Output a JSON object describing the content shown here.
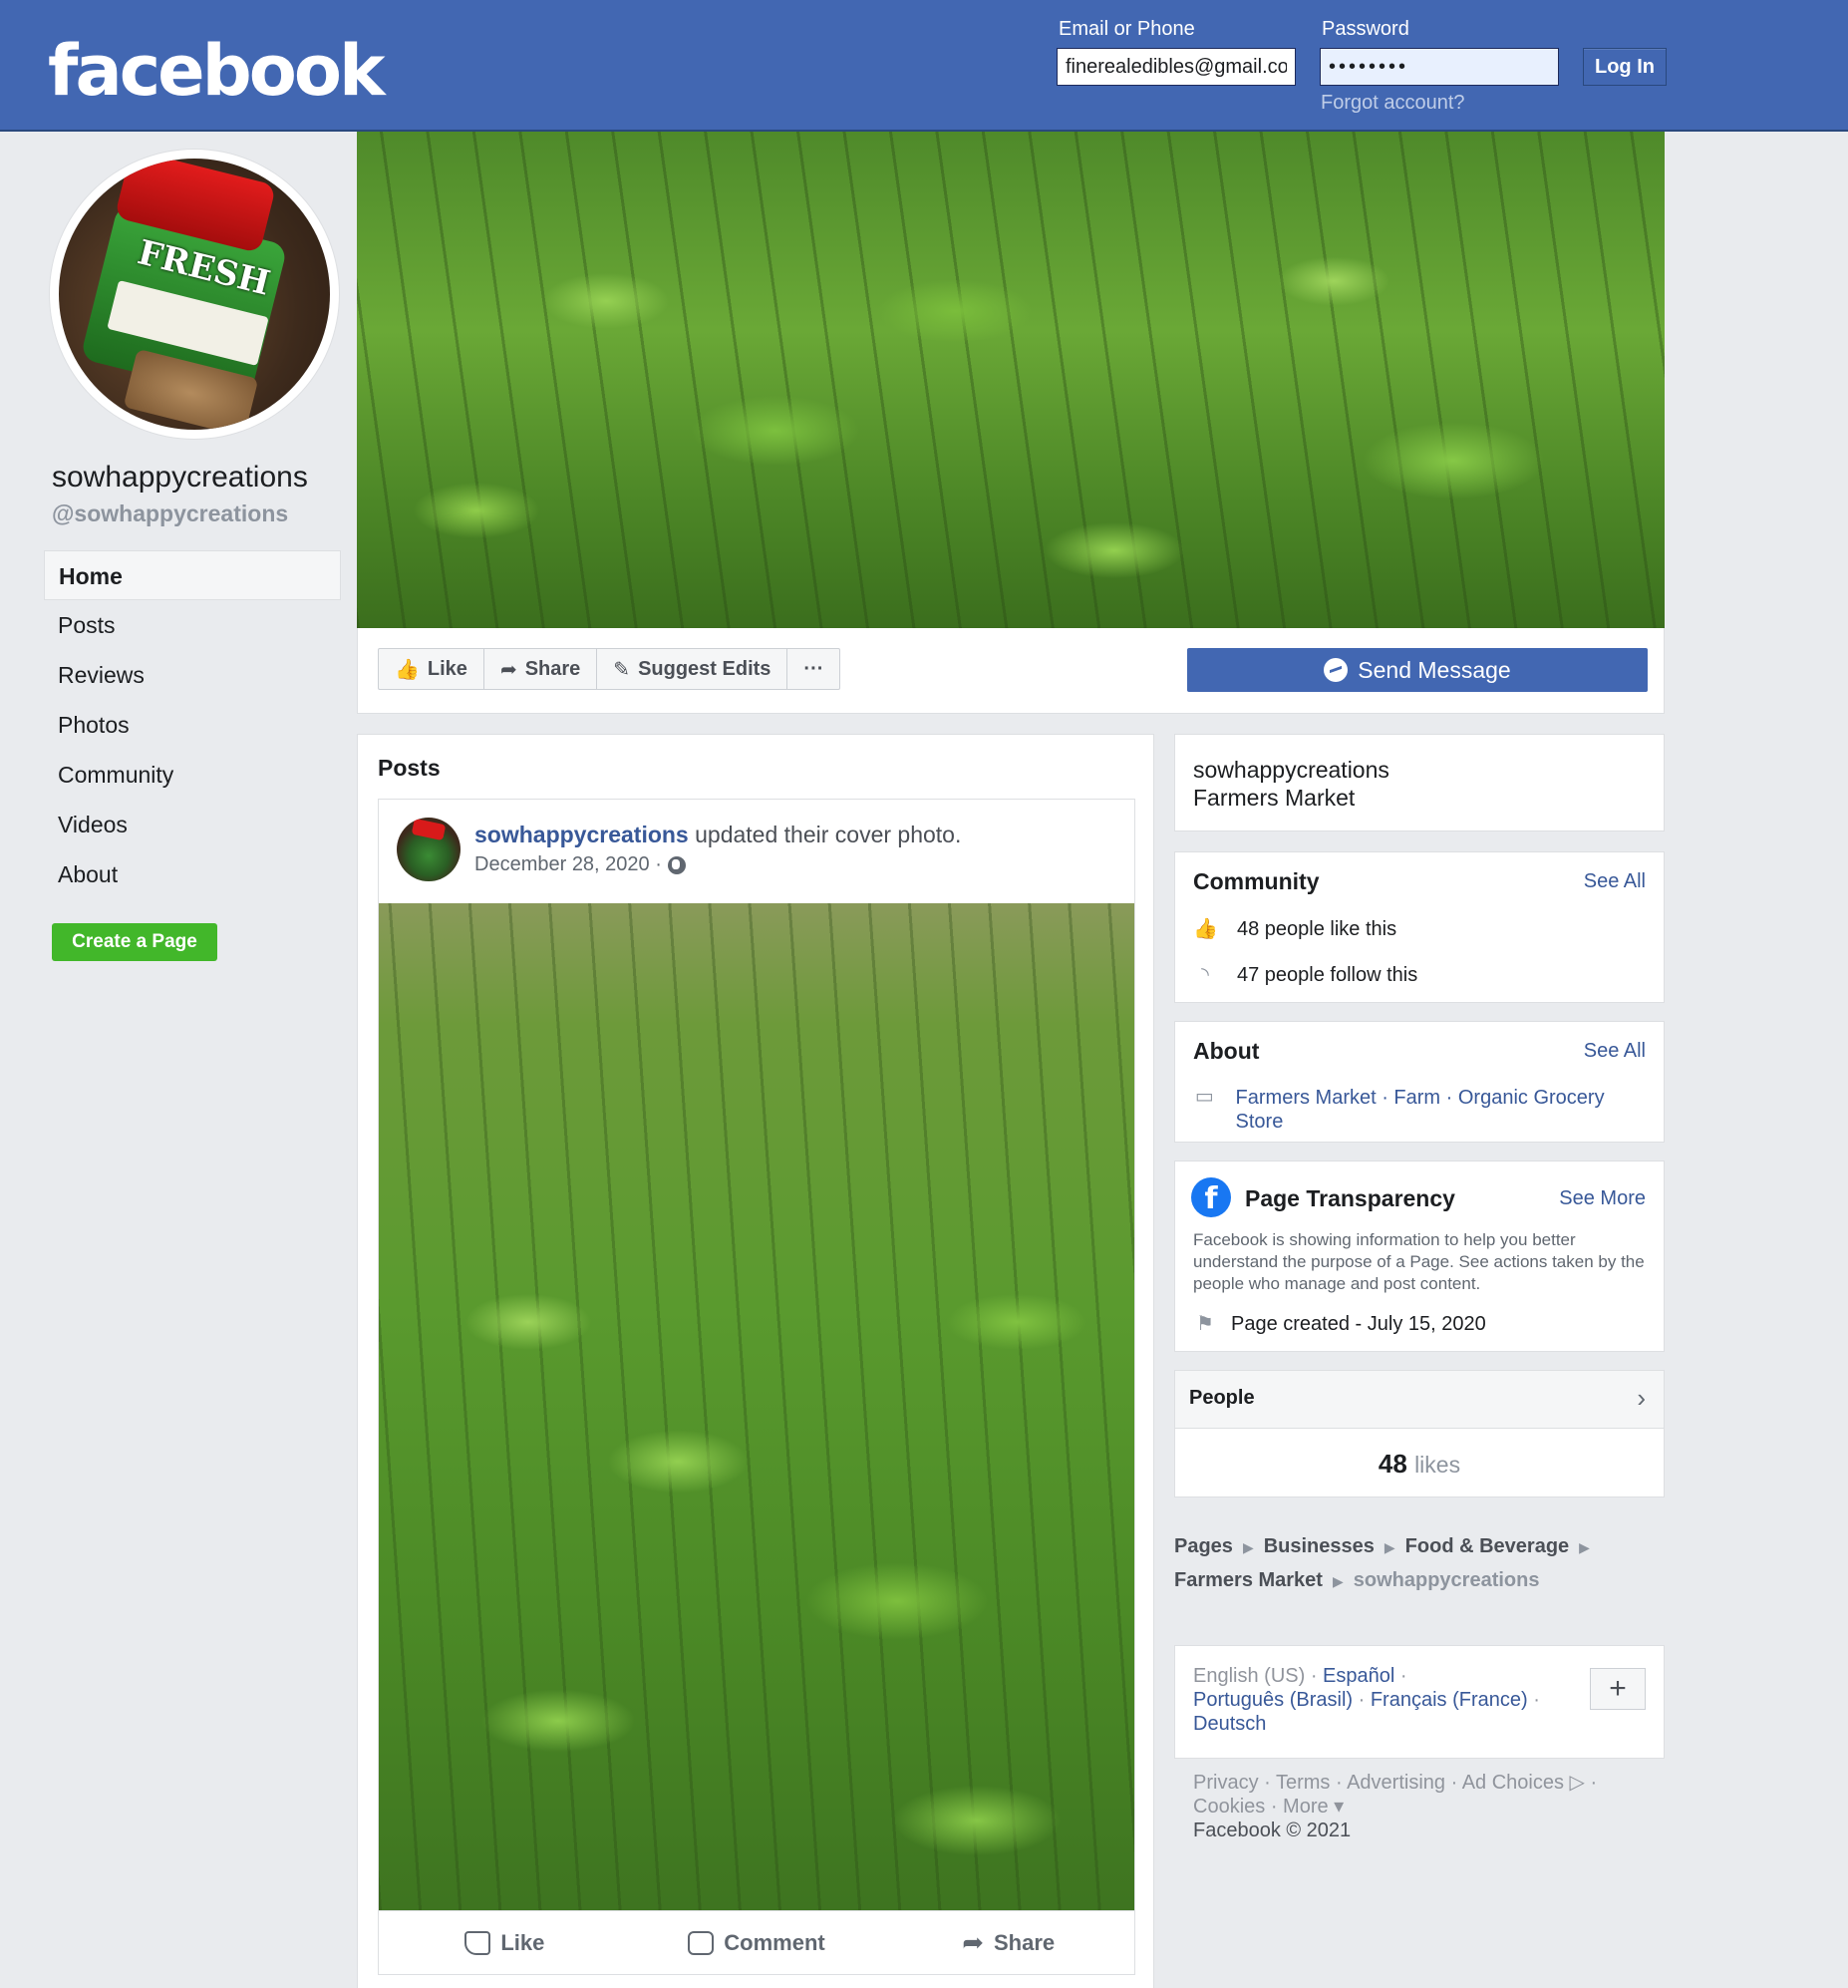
{
  "header": {
    "logo": "facebook",
    "email_label": "Email or Phone",
    "email_value": "finerealedibles@gmail.com",
    "password_label": "Password",
    "password_value": "••••••••",
    "login_button": "Log In",
    "forgot_link": "Forgot account?"
  },
  "profile": {
    "name": "sowhappycreations",
    "handle": "@sowhappycreations",
    "jar_text": "FRESH"
  },
  "nav": {
    "items": [
      "Home",
      "Posts",
      "Reviews",
      "Photos",
      "Community",
      "Videos",
      "About"
    ],
    "active": "Home",
    "create_page": "Create a Page"
  },
  "actions": {
    "like": "Like",
    "share": "Share",
    "suggest_edits": "Suggest Edits",
    "more": "···",
    "send_message": "Send Message"
  },
  "posts": {
    "title": "Posts",
    "post": {
      "author": "sowhappycreations",
      "action_text": " updated their cover photo.",
      "date": "December 28, 2020 ·",
      "like": "Like",
      "comment": "Comment",
      "share": "Share"
    }
  },
  "sidebar": {
    "info": {
      "name": "sowhappycreations",
      "category": "Farmers Market"
    },
    "community": {
      "title": "Community",
      "see_all": "See All",
      "likes": "48 people like this",
      "follows": "47 people follow this"
    },
    "about": {
      "title": "About",
      "see_all": "See All",
      "categories": "Farmers Market · Farm · Organic Grocery Store"
    },
    "transparency": {
      "title": "Page Transparency",
      "see_more": "See More",
      "text": "Facebook is showing information to help you better understand the purpose of a Page. See actions taken by the people who manage and post content.",
      "created": "Page created - July 15, 2020"
    },
    "people": {
      "title": "People",
      "count": "48",
      "count_label": "likes"
    }
  },
  "breadcrumb": {
    "items": [
      "Pages",
      "Businesses",
      "Food & Beverage",
      "Farmers Market"
    ],
    "last": "sowhappycreations"
  },
  "languages": {
    "current": "English (US)",
    "others": [
      "Español",
      "Português (Brasil)",
      "Français (France)",
      "Deutsch"
    ]
  },
  "footer": {
    "links_line1": "Privacy · Terms · Advertising · Ad Choices ▷ ·",
    "links_line2": "Cookies · More ▾",
    "copyright": "Facebook © 2021"
  },
  "colors": {
    "brand": "#4267b2",
    "link": "#385898",
    "create_page": "#42b72a"
  }
}
